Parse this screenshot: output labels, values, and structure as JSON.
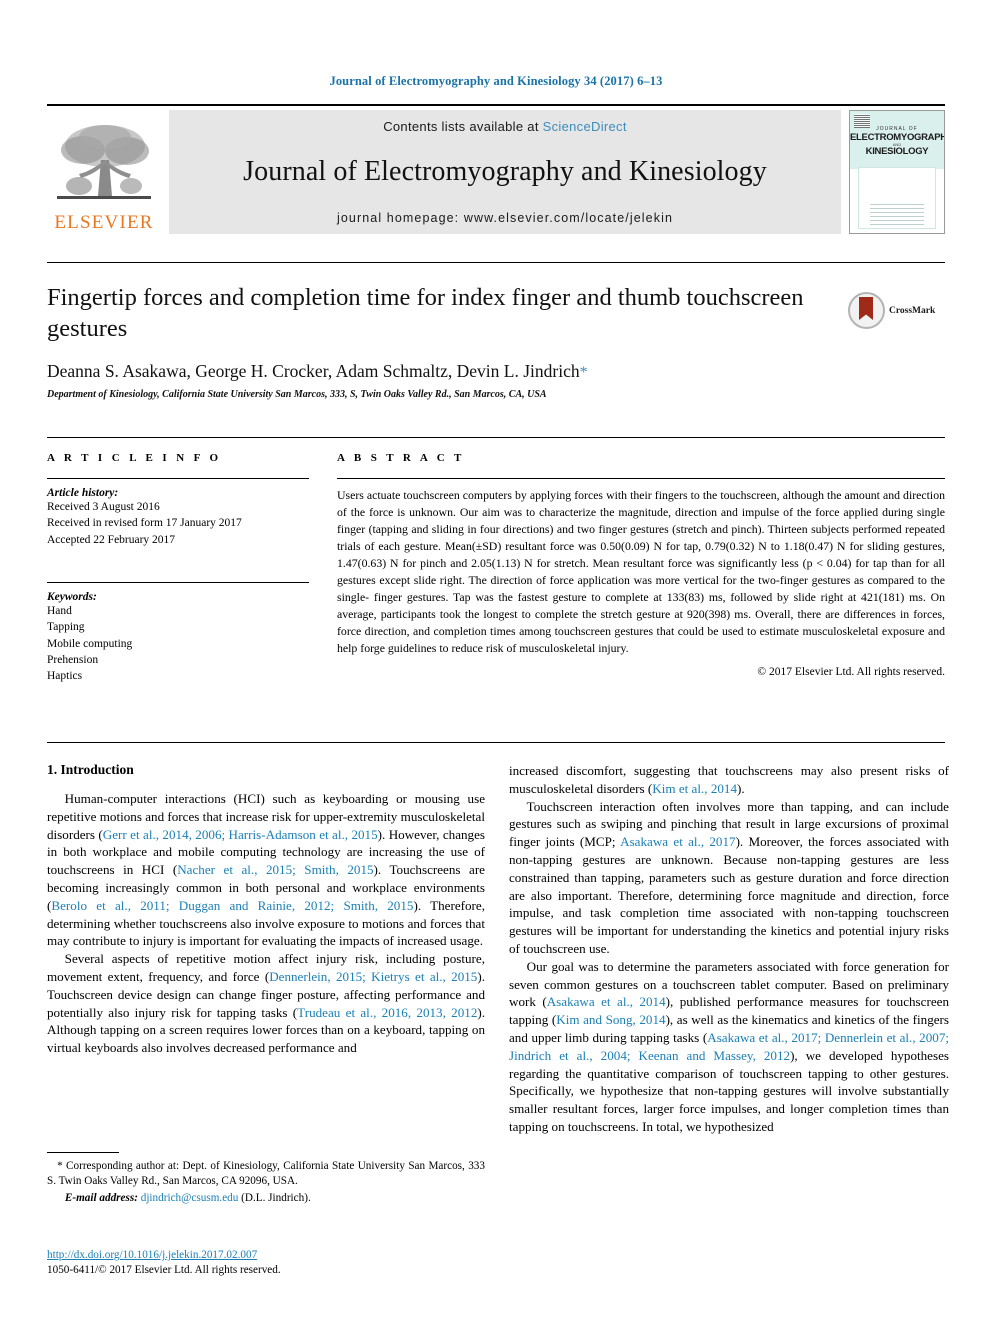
{
  "running_head": "Journal of Electromyography and Kinesiology 34 (2017) 6–13",
  "masthead": {
    "publisher_name": "ELSEVIER",
    "contents_prefix": "Contents lists available at ",
    "sciencedirect": "ScienceDirect",
    "journal_title": "Journal of Electromyography and Kinesiology",
    "homepage": "journal homepage: www.elsevier.com/locate/jelekin",
    "cover": {
      "line1": "JOURNAL OF",
      "line2": "ELECTROMYOGRAPHY",
      "line3": "AND",
      "line4": "KINESIOLOGY"
    }
  },
  "article": {
    "title": "Fingertip forces and completion time for index finger and thumb touchscreen gestures",
    "authors": "Deanna S. Asakawa, George H. Crocker, Adam Schmaltz, Devin L. Jindrich",
    "corresponding_marker": "*",
    "affiliation": "Department of Kinesiology, California State University San Marcos, 333, S, Twin Oaks Valley Rd., San Marcos, CA, USA",
    "crossmark_label": "CrossMark"
  },
  "article_info": {
    "heading": "A R T I C L E   I N F O",
    "history_label": "Article history:",
    "history": [
      "Received 3 August 2016",
      "Received in revised form 17 January 2017",
      "Accepted 22 February 2017"
    ],
    "keywords_label": "Keywords:",
    "keywords": [
      "Hand",
      "Tapping",
      "Mobile computing",
      "Prehension",
      "Haptics"
    ]
  },
  "abstract": {
    "heading": "A B S T R A C T",
    "text": "Users actuate touchscreen computers by applying forces with their fingers to the touchscreen, although the amount and direction of the force is unknown. Our aim was to characterize the magnitude, direction and impulse of the force applied during single finger (tapping and sliding in four directions) and two finger gestures (stretch and pinch). Thirteen subjects performed repeated trials of each gesture. Mean(±SD) resultant force was 0.50(0.09) N for tap, 0.79(0.32) N to 1.18(0.47) N for sliding gestures, 1.47(0.63) N for pinch and 2.05(1.13) N for stretch. Mean resultant force was significantly less (p < 0.04) for tap than for all gestures except slide right. The direction of force application was more vertical for the two-finger gestures as compared to the single- finger gestures. Tap was the fastest gesture to complete at 133(83) ms, followed by slide right at 421(181) ms. On average, participants took the longest to complete the stretch gesture at 920(398) ms. Overall, there are differences in forces, force direction, and completion times among touchscreen gestures that could be used to estimate musculoskeletal exposure and help forge guidelines to reduce risk of musculoskeletal injury.",
    "copyright": "© 2017 Elsevier Ltd. All rights reserved."
  },
  "introduction": {
    "heading": "1. Introduction",
    "left_paragraphs": [
      {
        "runs": [
          {
            "t": "Human-computer interactions (HCI) such as keyboarding or mousing use repetitive motions and forces that increase risk for upper-extremity musculoskeletal disorders ("
          },
          {
            "t": "Gerr et al., 2014, 2006; Harris-Adamson et al., 2015",
            "cite": true
          },
          {
            "t": "). However, changes in both workplace and mobile computing technology are increasing the use of touchscreens in HCI ("
          },
          {
            "t": "Nacher et al., 2015; Smith, 2015",
            "cite": true
          },
          {
            "t": "). Touchscreens are becoming increasingly common in both personal and workplace environments ("
          },
          {
            "t": "Berolo et al., 2011; Duggan and Rainie, 2012; Smith, 2015",
            "cite": true
          },
          {
            "t": "). Therefore, determining whether touchscreens also involve exposure to motions and forces that may contribute to injury is important for evaluating the impacts of increased usage."
          }
        ]
      },
      {
        "runs": [
          {
            "t": "Several aspects of repetitive motion affect injury risk, including posture, movement extent, frequency, and force ("
          },
          {
            "t": "Dennerlein, 2015; Kietrys et al., 2015",
            "cite": true
          },
          {
            "t": "). Touchscreen device design can change finger posture, affecting performance and potentially also injury risk for tapping tasks ("
          },
          {
            "t": "Trudeau et al., 2016, 2013, 2012",
            "cite": true
          },
          {
            "t": "). Although tapping on a screen requires lower forces than on a keyboard, tapping on virtual keyboards also involves decreased performance and"
          }
        ]
      }
    ],
    "right_paragraphs": [
      {
        "continued": true,
        "runs": [
          {
            "t": "increased discomfort, suggesting that touchscreens may also present risks of musculoskeletal disorders ("
          },
          {
            "t": "Kim et al., 2014",
            "cite": true
          },
          {
            "t": ")."
          }
        ]
      },
      {
        "runs": [
          {
            "t": "Touchscreen interaction often involves more than tapping, and can include gestures such as swiping and pinching that result in large excursions of proximal finger joints (MCP; "
          },
          {
            "t": "Asakawa et al., 2017",
            "cite": true
          },
          {
            "t": "). Moreover, the forces associated with non-tapping gestures are unknown. Because non-tapping gestures are less constrained than tapping, parameters such as gesture duration and force direction are also important. Therefore, determining force magnitude and direction, force impulse, and task completion time associated with non-tapping touchscreen gestures will be important for understanding the kinetics and potential injury risks of touchscreen use."
          }
        ]
      },
      {
        "runs": [
          {
            "t": "Our goal was to determine the parameters associated with force generation for seven common gestures on a touchscreen tablet computer. Based on preliminary work ("
          },
          {
            "t": "Asakawa et al., 2014",
            "cite": true
          },
          {
            "t": "), published performance measures for touchscreen tapping ("
          },
          {
            "t": "Kim and Song, 2014",
            "cite": true
          },
          {
            "t": "), as well as the kinematics and kinetics of the fingers and upper limb during tapping tasks ("
          },
          {
            "t": "Asakawa et al., 2017; Dennerlein et al., 2007; Jindrich et al., 2004; Keenan and Massey, 2012",
            "cite": true
          },
          {
            "t": "), we developed hypotheses regarding the quantitative comparison of touchscreen tapping to other gestures. Specifically, we hypothesize that non-tapping gestures will involve substantially smaller resultant forces, larger force impulses, and longer completion times than tapping on touchscreens. In total, we hypothesized"
          }
        ]
      }
    ]
  },
  "footnote": {
    "corresponding": "* Corresponding author at: Dept. of Kinesiology, California State University San Marcos, 333 S. Twin Oaks Valley Rd., San Marcos, CA 92096, USA.",
    "email_label": "E-mail address:",
    "email": "djindrich@csusm.edu",
    "email_suffix": "(D.L. Jindrich)."
  },
  "imprint": {
    "doi": "http://dx.doi.org/10.1016/j.jelekin.2017.02.007",
    "issn_line": "1050-6411/© 2017 Elsevier Ltd. All rights reserved."
  },
  "colors": {
    "link": "#1a7fb5",
    "sciencedirect": "#3c8dbc",
    "elsevier_orange": "#E87722",
    "band": "#e6e6e6"
  }
}
